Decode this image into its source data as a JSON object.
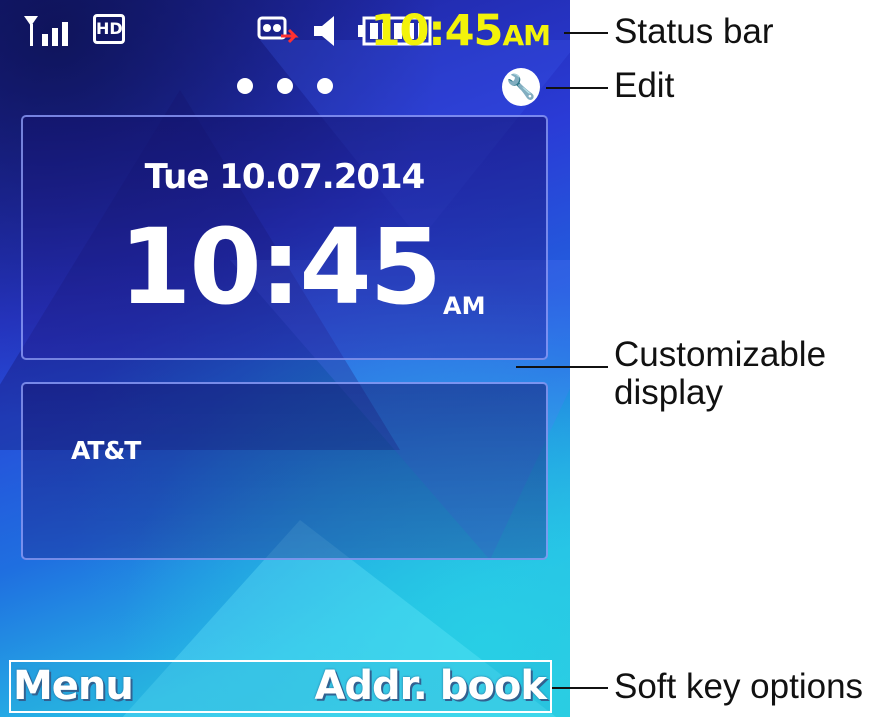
{
  "status_bar": {
    "signal_icon": "signal-strength-icon",
    "network_icon": "hd-voice-icon",
    "network_label": "HD",
    "message_icon": "voicemail-icon",
    "speaker_icon": "speaker-icon",
    "battery_icon": "battery-full-icon",
    "time": "10:45",
    "ampm": "AM",
    "time_color": "#f3f30a"
  },
  "home": {
    "page_count": 3,
    "edit_icon": "wrench-icon",
    "clock": {
      "date": "Tue 10.07.2014",
      "time": "10:45",
      "ampm": "AM"
    },
    "carrier": "AT&T"
  },
  "softkeys": {
    "left": "Menu",
    "right": "Addr. book"
  },
  "callouts": [
    {
      "label": "Status bar"
    },
    {
      "label": "Edit"
    },
    {
      "label": "Customizable"
    },
    {
      "label": "display"
    },
    {
      "label": "Soft key options"
    }
  ]
}
